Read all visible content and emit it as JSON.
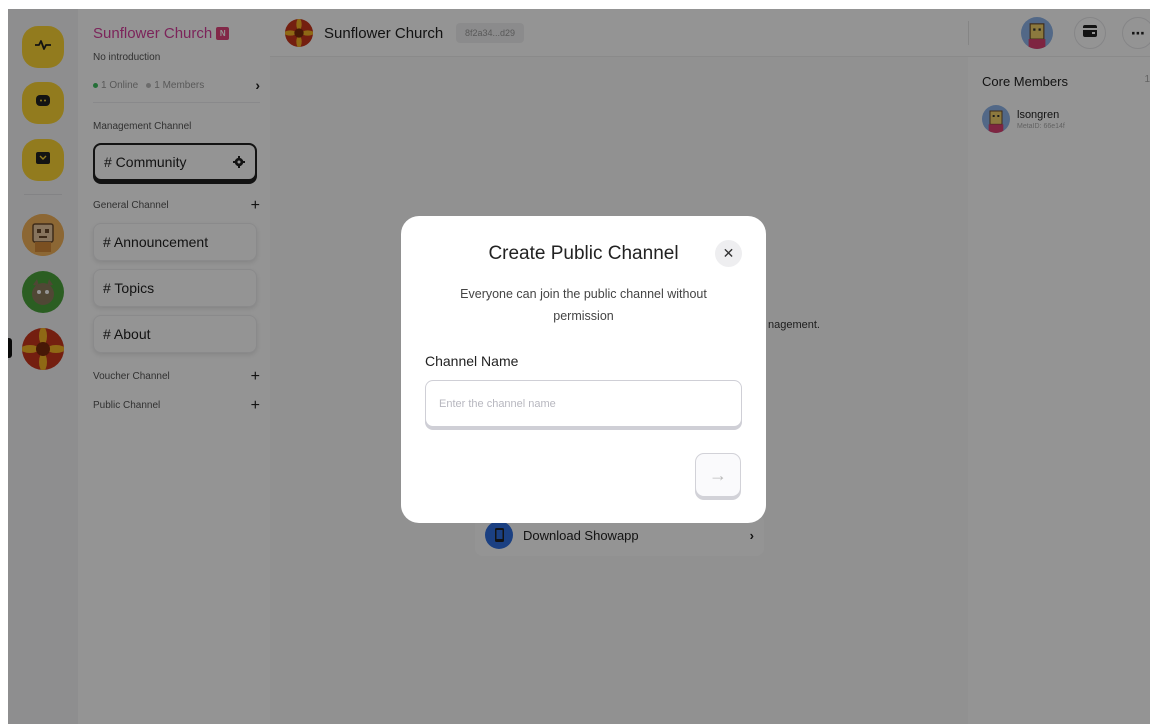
{
  "community": {
    "name": "Sunflower Church",
    "introduction": "No introduction",
    "online": "1 Online",
    "members": "1 Members"
  },
  "sidebar": {
    "management_label": "Management Channel",
    "management_channels": [
      {
        "label": "# Community"
      }
    ],
    "general_label": "General Channel",
    "general_channels": [
      {
        "label": "# Announcement"
      },
      {
        "label": "# Topics"
      },
      {
        "label": "# About"
      }
    ],
    "voucher_label": "Voucher Channel",
    "public_label": "Public Channel",
    "plus": "+"
  },
  "header": {
    "title": "Sunflower Church",
    "id_chip": "8f2a34...d29"
  },
  "main": {
    "background_text": "nagement.",
    "download_label": "Download Showapp"
  },
  "members_panel": {
    "title": "Core Members",
    "count": "1",
    "items": [
      {
        "name": "lsongren",
        "meta": "MetaID: 66e14f"
      }
    ]
  },
  "modal": {
    "title": "Create Public Channel",
    "description": "Everyone can join the public channel without permission",
    "field_label": "Channel Name",
    "field_value": "",
    "field_placeholder": "Enter the channel name",
    "close_glyph": "✕",
    "submit_glyph": "→"
  },
  "icons": {
    "rail": [
      "activity-icon",
      "chat-icon",
      "wallet-icon"
    ],
    "gear": "gear-icon",
    "chevron": "chevron-right-icon"
  },
  "colors": {
    "accent_yellow": "#fcd535",
    "community_name": "#d63f9c",
    "online_dot": "#3fbf5f"
  }
}
